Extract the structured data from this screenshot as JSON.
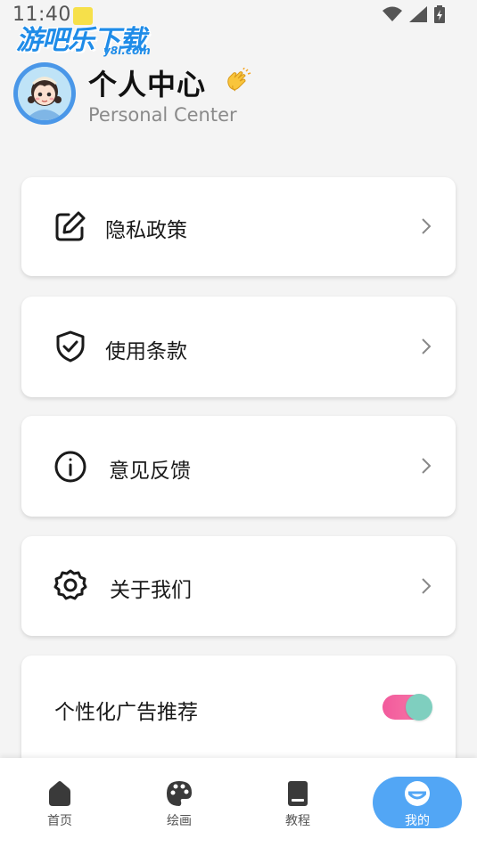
{
  "status": {
    "time": "11:40"
  },
  "watermark": {
    "main": "游吧乐下载",
    "sub": "y8l.com"
  },
  "header": {
    "title": "个人中心",
    "subtitle": "Personal Center"
  },
  "menu": [
    {
      "label": "隐私政策",
      "icon": "edit-icon"
    },
    {
      "label": "使用条款",
      "icon": "shield-check-icon"
    },
    {
      "label": "意见反馈",
      "icon": "info-icon"
    },
    {
      "label": "关于我们",
      "icon": "gear-icon"
    }
  ],
  "ad_setting": {
    "label": "个性化广告推荐",
    "enabled": true
  },
  "colors": {
    "accent": "#52a6f5",
    "toggle_on": "#f25a9c",
    "toggle_knob": "#7fcfbf"
  },
  "nav": [
    {
      "label": "首页",
      "icon": "home-icon"
    },
    {
      "label": "绘画",
      "icon": "palette-icon"
    },
    {
      "label": "教程",
      "icon": "book-icon"
    },
    {
      "label": "我的",
      "icon": "profile-icon",
      "active": true
    }
  ]
}
